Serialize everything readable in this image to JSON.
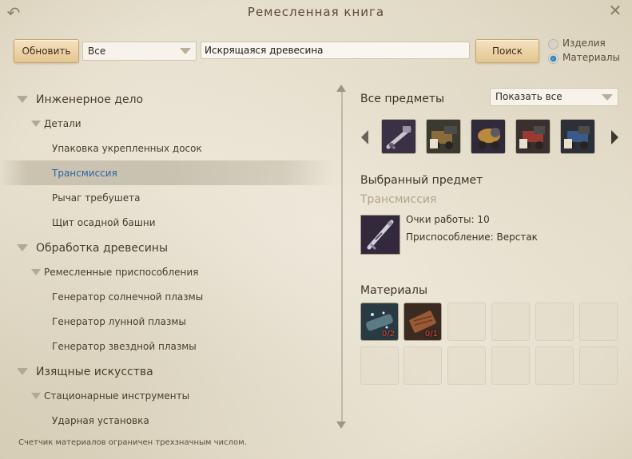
{
  "window": {
    "title": "Ремесленная книга"
  },
  "toolbar": {
    "refresh_label": "Обновить",
    "filter_value": "Все",
    "search_value": "Искрящаяся древесина",
    "search_label": "Поиск",
    "radio_products": "Изделия",
    "radio_materials": "Материалы",
    "radio_selected": "Материалы"
  },
  "tree": [
    {
      "level": 1,
      "label": "Инженерное дело"
    },
    {
      "level": 2,
      "label": "Детали"
    },
    {
      "level": 3,
      "label": "Упаковка укрепленных досок"
    },
    {
      "level": 3,
      "label": "Трансмиссия",
      "selected": true
    },
    {
      "level": 3,
      "label": "Рычаг требушета"
    },
    {
      "level": 3,
      "label": "Щит осадной башни"
    },
    {
      "level": 1,
      "label": "Обработка древесины"
    },
    {
      "level": 2,
      "label": "Ремесленные приспособления"
    },
    {
      "level": 3,
      "label": "Генератор солнечной плазмы"
    },
    {
      "level": 3,
      "label": "Генератор лунной плазмы"
    },
    {
      "level": 3,
      "label": "Генератор звездной плазмы"
    },
    {
      "level": 1,
      "label": "Изящные искусства"
    },
    {
      "level": 2,
      "label": "Стационарные инструменты"
    },
    {
      "level": 3,
      "label": "Ударная установка"
    }
  ],
  "footer": {
    "note": "Счетчик материалов ограничен трехзначным числом."
  },
  "right": {
    "all_items_title": "Все предметы",
    "show_select": "Показать все",
    "carousel_items": [
      "transmission-icon",
      "siege-cart-icon",
      "barrel-cannon-icon",
      "red-cart-icon",
      "blue-cart-icon"
    ],
    "selected_title": "Выбранный предмет",
    "selected_name": "Трансмиссия",
    "work_points": "Очки работы: 10",
    "tool": "Приспособление: Верстак",
    "materials_title": "Материалы",
    "materials": [
      {
        "icon": "sparkling-wood-icon",
        "count": "0/2"
      },
      {
        "icon": "lumber-plank-icon",
        "count": "0/1"
      }
    ]
  },
  "colors": {
    "accent_blue": "#2a64a8",
    "count_red": "#e04a3a",
    "button_gold": "#e4c690"
  }
}
